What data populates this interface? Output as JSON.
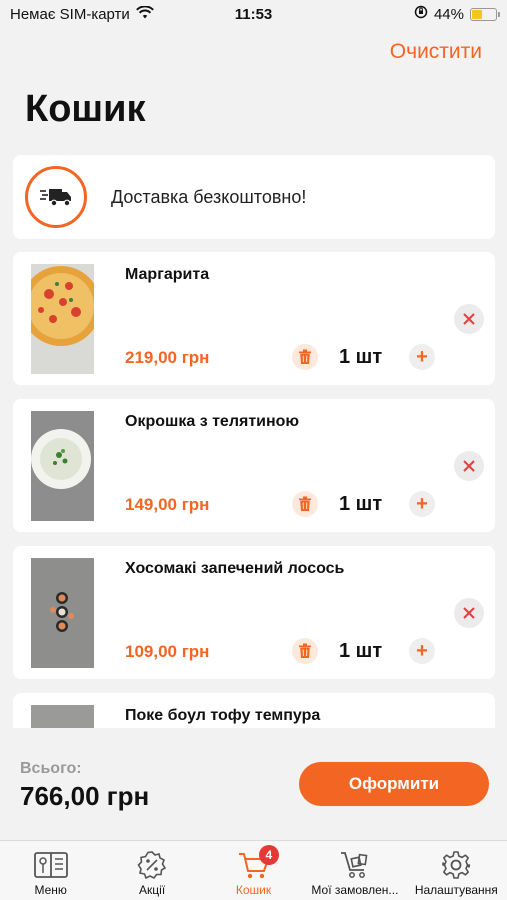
{
  "status_bar": {
    "carrier": "Немає SIM-карти",
    "time": "11:53",
    "battery": "44%",
    "battery_level": 0.44
  },
  "header": {
    "clear_label": "Очистити",
    "title": "Кошик"
  },
  "delivery": {
    "text": "Доставка безкоштовно!",
    "icon": "delivery-truck-icon"
  },
  "items": [
    {
      "name": "Маргарита",
      "price": "219,00 грн",
      "qty": "1 шт",
      "image": "pizza"
    },
    {
      "name": "Окрошка з телятиною",
      "price": "149,00 грн",
      "qty": "1 шт",
      "image": "soup"
    },
    {
      "name": "Хосомакі запечений лосось",
      "price": "109,00 грн",
      "qty": "1 шт",
      "image": "rolls"
    },
    {
      "name": "Поке боул тофу темпура",
      "price": "",
      "qty": "",
      "image": "bowl"
    }
  ],
  "summary": {
    "total_label": "Всього:",
    "total_value": "766,00 грн",
    "checkout_label": "Оформити"
  },
  "tabs": [
    {
      "label": "Меню",
      "icon": "menu-book-icon"
    },
    {
      "label": "Акції",
      "icon": "discount-icon"
    },
    {
      "label": "Кошик",
      "icon": "cart-icon",
      "badge": "4",
      "active": true
    },
    {
      "label": "Мої замовлен...",
      "icon": "orders-cart-icon"
    },
    {
      "label": "Налаштування",
      "icon": "gear-icon"
    }
  ],
  "colors": {
    "accent": "#f26522",
    "background": "#f2f2f2",
    "badge": "#e53935"
  }
}
